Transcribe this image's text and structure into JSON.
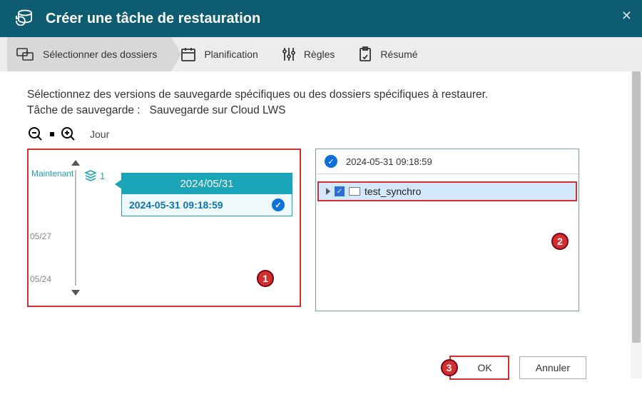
{
  "header": {
    "title": "Créer une tâche de restauration"
  },
  "steps": {
    "select": "Sélectionner des dossiers",
    "schedule": "Planification",
    "rules": "Règles",
    "summary": "Résumé"
  },
  "instruction": "Sélectionnez des versions de sauvegarde spécifiques ou des dossiers spécifiques à restaurer.",
  "task_label": "Tâche de sauvegarde :",
  "task_name": "Sauvegarde sur Cloud LWS",
  "zoom": {
    "unit": "Jour"
  },
  "timeline": {
    "now": "Maintenant",
    "ticks": [
      "05/27",
      "05/24"
    ],
    "version_count": "1",
    "group_date": "2024/05/31",
    "version_label": "2024-05-31 09:18:59"
  },
  "right_panel": {
    "selected_version": "2024-05-31 09:18:59",
    "folder": "test_synchro"
  },
  "badges": {
    "left": "1",
    "right": "2",
    "ok": "3"
  },
  "buttons": {
    "ok": "OK",
    "cancel": "Annuler"
  }
}
